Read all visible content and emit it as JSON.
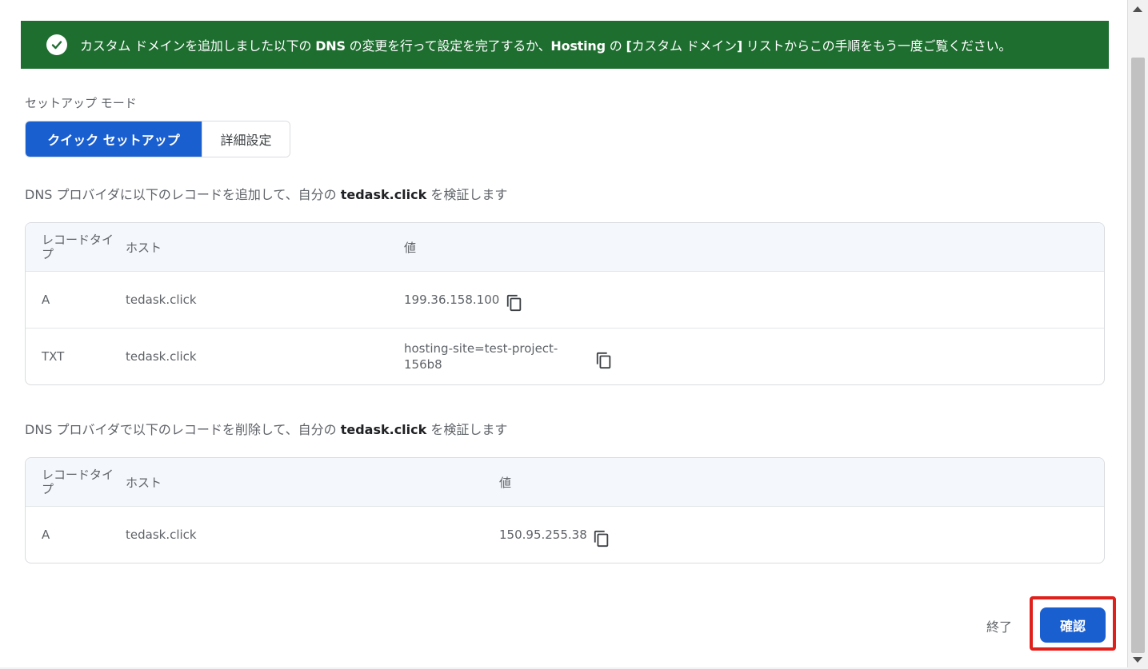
{
  "banner": {
    "parts": [
      {
        "text": "カスタム ドメインを追加しました以下の ",
        "bold": false
      },
      {
        "text": "DNS",
        "bold": true
      },
      {
        "text": " の変更を行って設定を完了するか、",
        "bold": false
      },
      {
        "text": "Hosting",
        "bold": true
      },
      {
        "text": " の ",
        "bold": false
      },
      {
        "text": "[",
        "bold": true
      },
      {
        "text": "カスタム ドメイン",
        "bold": false
      },
      {
        "text": "]",
        "bold": true
      },
      {
        "text": " リストからこの手順をもう一度ご覧ください。",
        "bold": false
      }
    ],
    "color": "#1e6e30"
  },
  "setup_mode": {
    "label": "セットアップ モード",
    "options": [
      "クイック セットアップ",
      "詳細設定"
    ],
    "selected": "クイック セットアップ"
  },
  "add_section": {
    "prefix": "DNS プロバイダに以下のレコードを追加して、自分の ",
    "domain": "tedask.click",
    "suffix": " を検証します",
    "headers": {
      "type": "レコードタイプ",
      "host": "ホスト",
      "value": "値"
    },
    "rows": [
      {
        "type": "A",
        "host": "tedask.click",
        "value": "199.36.158.100",
        "copy_icon": "copy-icon"
      },
      {
        "type": "TXT",
        "host": "tedask.click",
        "value": "hosting-site=test-project-156b8",
        "copy_icon": "copy-icon"
      }
    ]
  },
  "remove_section": {
    "prefix": "DNS プロバイダで以下のレコードを削除して、自分の ",
    "domain": "tedask.click",
    "suffix": " を検証します",
    "headers": {
      "type": "レコードタイプ",
      "host": "ホスト",
      "value": "値"
    },
    "rows": [
      {
        "type": "A",
        "host": "tedask.click",
        "value": "150.95.255.38",
        "copy_icon": "copy-icon"
      }
    ]
  },
  "footer": {
    "end_label": "終了",
    "confirm_label": "確認",
    "accent": "#1a5fd0",
    "highlight": "#e0201b"
  }
}
